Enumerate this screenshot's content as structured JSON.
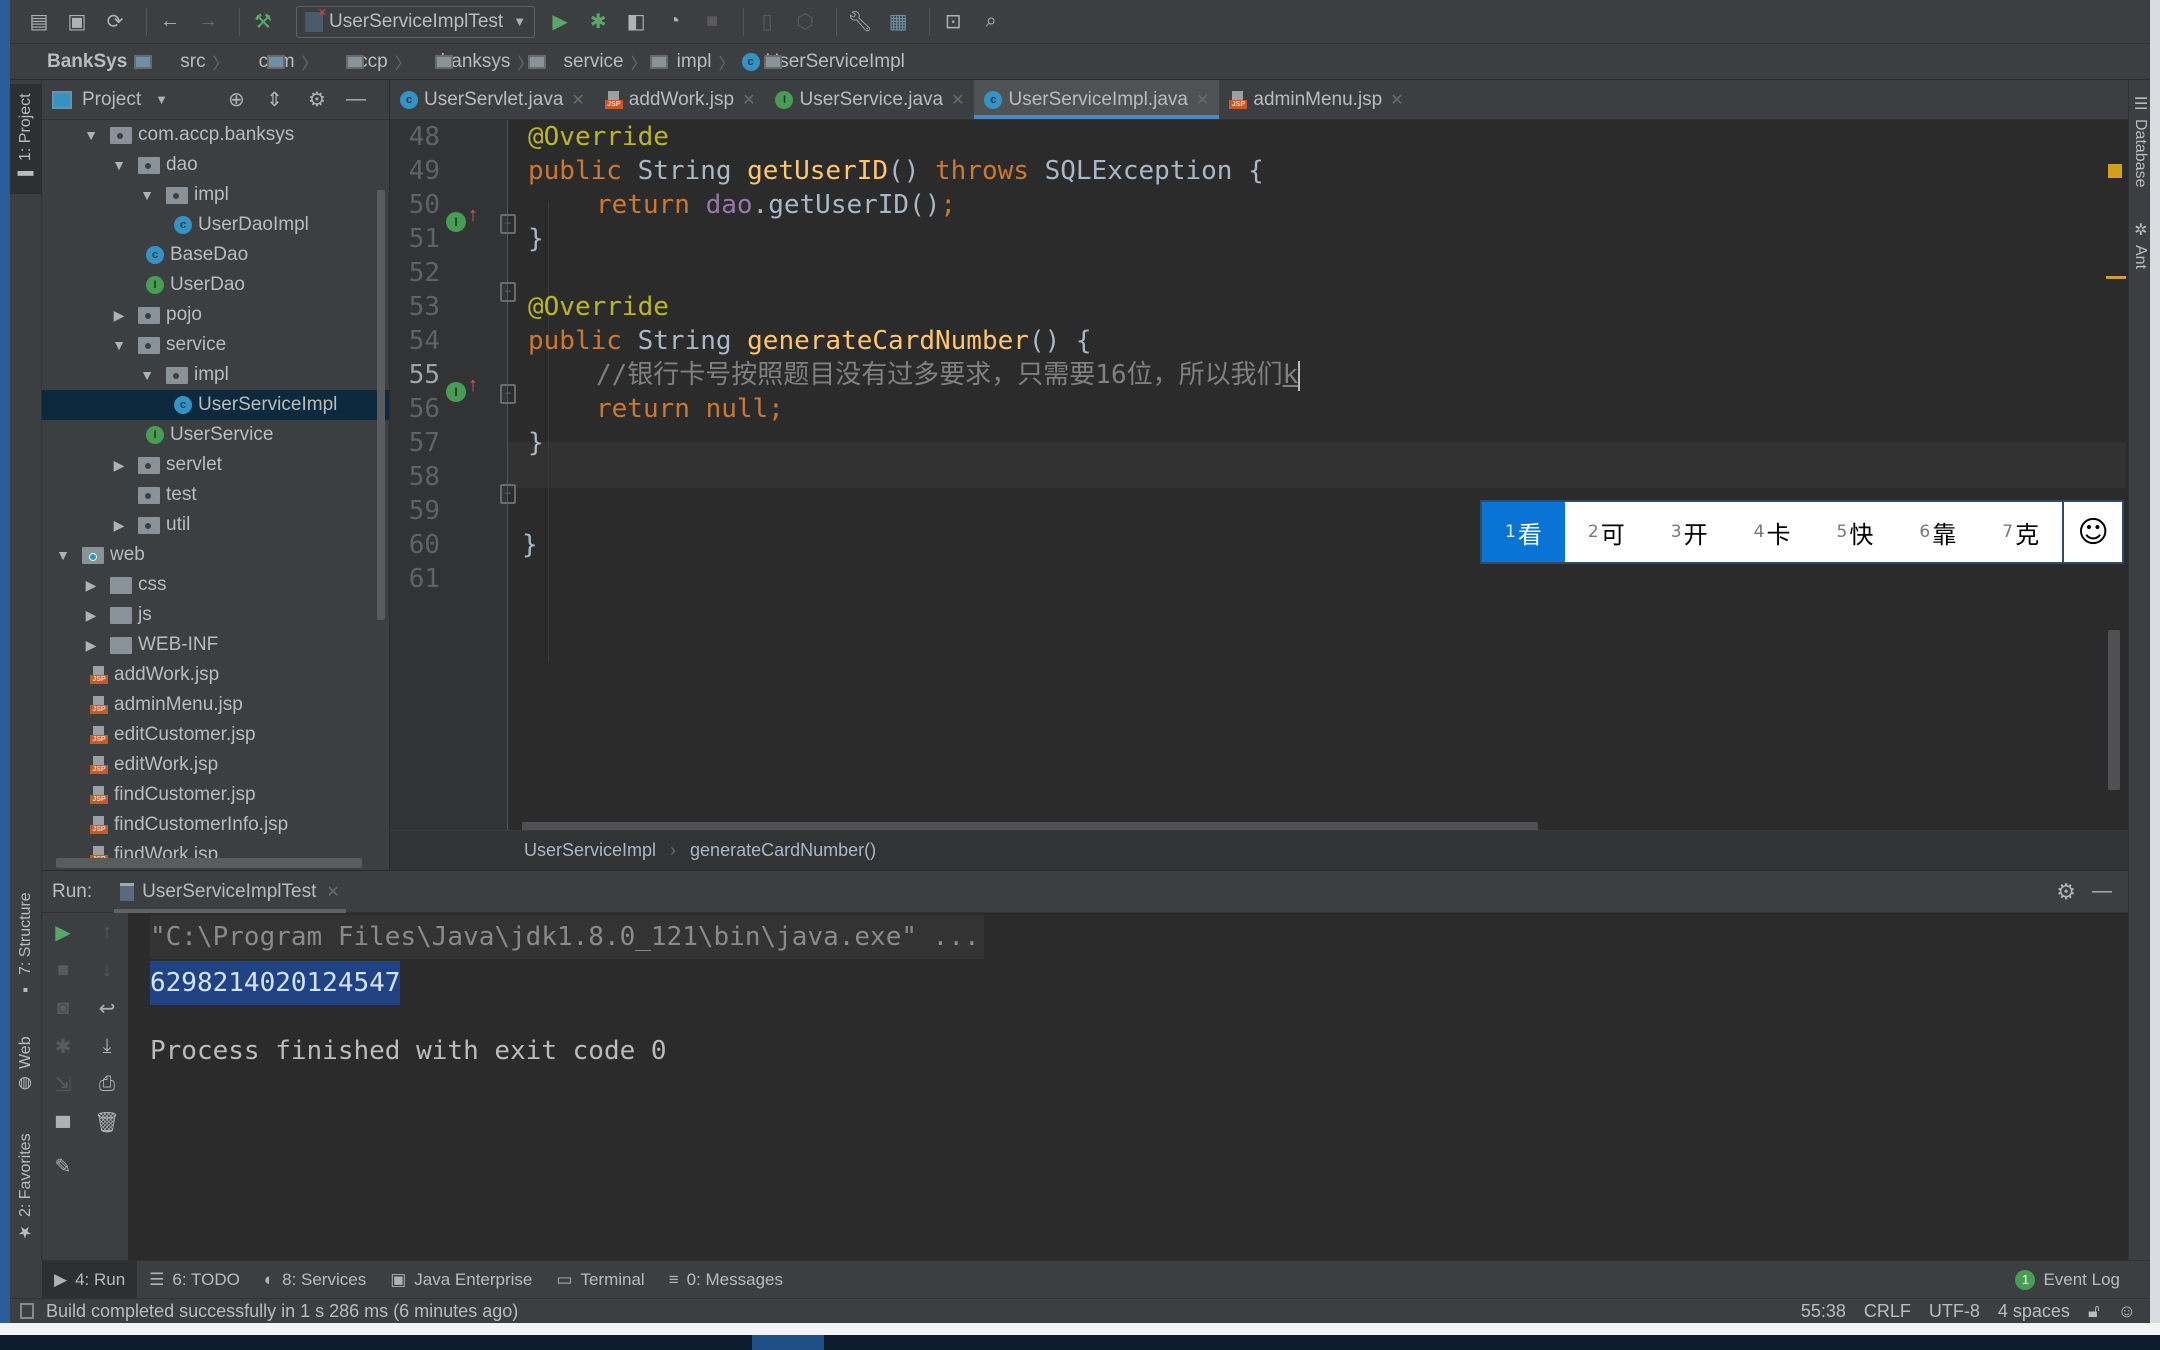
{
  "toolbar": {
    "buttons": [
      "open-icon",
      "save-all-icon",
      "sync-icon",
      "back-icon",
      "forward-icon",
      "build-hammer-icon"
    ],
    "run_config": "UserServiceImplTest",
    "right_buttons": [
      "run-icon",
      "debug-icon",
      "coverage-icon",
      "profile-icon",
      "stop-icon",
      "attach-icon",
      "deploy-icon",
      "settings-wrench-icon",
      "project-structure-icon",
      "terminal-icon",
      "search-icon"
    ]
  },
  "navbar": {
    "crumbs": [
      "BankSys",
      "src",
      "com",
      "accp",
      "banksys",
      "service",
      "impl",
      "UserServiceImpl"
    ]
  },
  "left_strip": {
    "project_tab": "1: Project",
    "structure_tab": "7: Structure",
    "web_tab": "Web",
    "favorites_tab": "2: Favorites"
  },
  "project": {
    "title": "Project",
    "tree": [
      {
        "label": "com.accp.banksys",
        "type": "package",
        "depth": 1,
        "expanded": true
      },
      {
        "label": "dao",
        "type": "package",
        "depth": 2,
        "expanded": true
      },
      {
        "label": "impl",
        "type": "package",
        "depth": 3,
        "expanded": true
      },
      {
        "label": "UserDaoImpl",
        "type": "class",
        "depth": 4
      },
      {
        "label": "BaseDao",
        "type": "class",
        "depth": 3
      },
      {
        "label": "UserDao",
        "type": "interface",
        "depth": 3
      },
      {
        "label": "pojo",
        "type": "package",
        "depth": 2,
        "expanded": false
      },
      {
        "label": "service",
        "type": "package",
        "depth": 2,
        "expanded": true
      },
      {
        "label": "impl",
        "type": "package",
        "depth": 3,
        "expanded": true
      },
      {
        "label": "UserServiceImpl",
        "type": "class",
        "depth": 4,
        "selected": true
      },
      {
        "label": "UserService",
        "type": "interface",
        "depth": 3
      },
      {
        "label": "servlet",
        "type": "package",
        "depth": 2,
        "expanded": false
      },
      {
        "label": "test",
        "type": "package",
        "depth": 2
      },
      {
        "label": "util",
        "type": "package",
        "depth": 2,
        "expanded": false
      },
      {
        "label": "web",
        "type": "webroot",
        "depth": 0,
        "expanded": true
      },
      {
        "label": "css",
        "type": "folder",
        "depth": 1,
        "expanded": false
      },
      {
        "label": "js",
        "type": "folder",
        "depth": 1,
        "expanded": false
      },
      {
        "label": "WEB-INF",
        "type": "folder",
        "depth": 1,
        "expanded": false
      },
      {
        "label": "addWork.jsp",
        "type": "jsp",
        "depth": 1
      },
      {
        "label": "adminMenu.jsp",
        "type": "jsp",
        "depth": 1
      },
      {
        "label": "editCustomer.jsp",
        "type": "jsp",
        "depth": 1
      },
      {
        "label": "editWork.jsp",
        "type": "jsp",
        "depth": 1
      },
      {
        "label": "findCustomer.jsp",
        "type": "jsp",
        "depth": 1
      },
      {
        "label": "findCustomerInfo.jsp",
        "type": "jsp",
        "depth": 1
      },
      {
        "label": "findWork.jsp",
        "type": "jsp",
        "depth": 1
      }
    ]
  },
  "editor": {
    "tabs": [
      {
        "label": "UserServlet.java",
        "type": "class"
      },
      {
        "label": "addWork.jsp",
        "type": "jsp"
      },
      {
        "label": "UserService.java",
        "type": "interface"
      },
      {
        "label": "UserServiceImpl.java",
        "type": "class",
        "active": true
      },
      {
        "label": "adminMenu.jsp",
        "type": "jsp"
      }
    ],
    "line_numbers": [
      "48",
      "49",
      "50",
      "51",
      "52",
      "53",
      "54",
      "55",
      "56",
      "57",
      "58",
      "59",
      "60",
      "61"
    ],
    "code": {
      "l48": "@Override",
      "l49_kw": "public ",
      "l49_type": "String ",
      "l49_fn": "getUserID",
      "l49_rest1": "() ",
      "l49_throws": "throws ",
      "l49_rest2": "SQLException {",
      "l50_kw": "return ",
      "l50_fld": "dao",
      "l50_rest": ".getUserID()",
      "l50_semi": ";",
      "l51": "}",
      "l53": "@Override",
      "l54_kw": "public ",
      "l54_type": "String ",
      "l54_fn": "generateCardNumber",
      "l54_rest": "() {",
      "l55_comment": "//银行卡号按照题目没有过多要求，只需要16位，所以我们",
      "l55_typed": "k",
      "l56_kw": "return null;",
      "l57": "}",
      "l60": "}"
    },
    "breadcrumb": [
      "UserServiceImpl",
      "generateCardNumber()"
    ]
  },
  "ime": {
    "candidates": [
      {
        "n": "1",
        "c": "看"
      },
      {
        "n": "2",
        "c": "可"
      },
      {
        "n": "3",
        "c": "开"
      },
      {
        "n": "4",
        "c": "卡"
      },
      {
        "n": "5",
        "c": "快"
      },
      {
        "n": "6",
        "c": "靠"
      },
      {
        "n": "7",
        "c": "克"
      }
    ],
    "emoji": "☺"
  },
  "right_strip": {
    "database_tab": "Database",
    "ant_tab": "Ant"
  },
  "run": {
    "label": "Run:",
    "tab": "UserServiceImplTest",
    "console": {
      "cmd": "\"C:\\Program Files\\Java\\jdk1.8.0_121\\bin\\java.exe\" ...",
      "output": "6298214020124547",
      "exit": "Process finished with exit code 0"
    }
  },
  "bottom_tabs": [
    {
      "label": "4: Run",
      "icon": "▶",
      "active": true
    },
    {
      "label": "6: TODO",
      "icon": "☰"
    },
    {
      "label": "8: Services",
      "icon": "◐"
    },
    {
      "label": "Java Enterprise",
      "icon": "▣"
    },
    {
      "label": "Terminal",
      "icon": "▭"
    },
    {
      "label": "0: Messages",
      "icon": "≡"
    }
  ],
  "event_log": {
    "count": "1",
    "label": "Event Log"
  },
  "status": {
    "message": "Build completed successfully in 1 s 286 ms (6 minutes ago)",
    "position": "55:38",
    "line_sep": "CRLF",
    "encoding": "UTF-8",
    "indent": "4 spaces"
  }
}
